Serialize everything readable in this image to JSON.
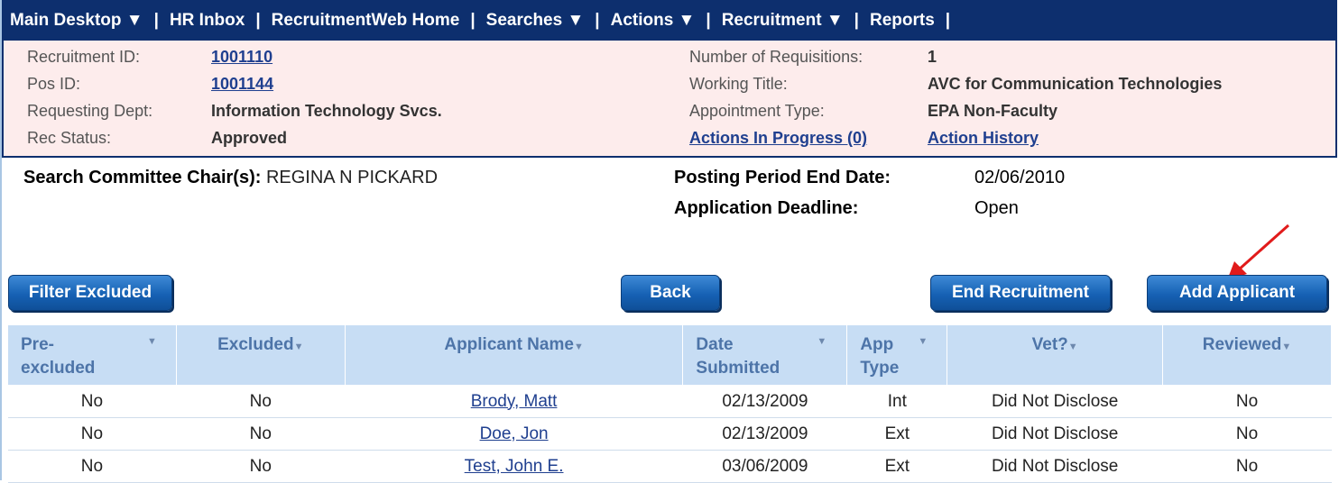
{
  "nav": {
    "items": [
      {
        "label": "Main Desktop ▼"
      },
      {
        "label": "HR Inbox"
      },
      {
        "label": "RecruitmentWeb Home"
      },
      {
        "label": "Searches ▼"
      },
      {
        "label": "Actions ▼"
      },
      {
        "label": "Recruitment ▼"
      },
      {
        "label": "Reports"
      }
    ],
    "separator": "|"
  },
  "info": {
    "recruitment_id": {
      "label": "Recruitment ID:",
      "value": "1001110"
    },
    "pos_id": {
      "label": "Pos ID:",
      "value": "1001144"
    },
    "requesting_dept": {
      "label": "Requesting Dept:",
      "value": "Information Technology Svcs."
    },
    "rec_status": {
      "label": "Rec Status:",
      "value": "Approved"
    },
    "num_requisitions": {
      "label": "Number of Requisitions:",
      "value": "1"
    },
    "working_title": {
      "label": "Working Title:",
      "value": "AVC for Communication Technologies"
    },
    "appointment_type": {
      "label": "Appointment Type:",
      "value": "EPA Non-Faculty"
    },
    "actions_in_progress": "Actions In Progress (0)",
    "action_history": "Action History"
  },
  "committee": {
    "chair_label": "Search Committee Chair(s):",
    "chair_value": "REGINA N PICKARD",
    "posting_end_label": "Posting Period End Date:",
    "posting_end_value": "02/06/2010",
    "deadline_label": "Application Deadline:",
    "deadline_value": "Open"
  },
  "buttons": {
    "filter_excluded": "Filter Excluded",
    "back": "Back",
    "end_recruitment": "End Recruitment",
    "add_applicant": "Add Applicant"
  },
  "table": {
    "headers": {
      "pre_excluded": "Pre- excluded",
      "excluded": "Excluded",
      "applicant_name": "Applicant Name",
      "date_submitted": "Date Submitted",
      "app_type": "App Type",
      "vet": "Vet?",
      "reviewed": "Reviewed"
    },
    "sort_glyph": "▼",
    "rows": [
      {
        "pre_excluded": "No",
        "excluded": "No",
        "name": "Brody, Matt",
        "date": "02/13/2009",
        "type": "Int",
        "vet": "Did Not Disclose",
        "reviewed": "No"
      },
      {
        "pre_excluded": "No",
        "excluded": "No",
        "name": "Doe, Jon",
        "date": "02/13/2009",
        "type": "Ext",
        "vet": "Did Not Disclose",
        "reviewed": "No"
      },
      {
        "pre_excluded": "No",
        "excluded": "No",
        "name": "Test, John E.",
        "date": "03/06/2009",
        "type": "Ext",
        "vet": "Did Not Disclose",
        "reviewed": "No"
      }
    ]
  },
  "colors": {
    "nav_bg": "#0d2f6e",
    "panel_bg": "#fdecec",
    "header_bg": "#c7ddf4",
    "button_blue": "#1661b4",
    "arrow_red": "#e11b1b"
  }
}
